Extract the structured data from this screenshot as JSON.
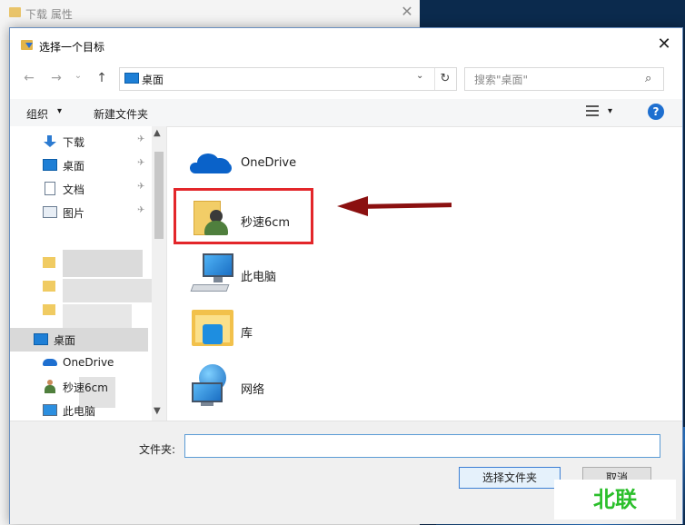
{
  "background_window": {
    "title": "下载 属性",
    "close": "✕"
  },
  "dialog": {
    "title": "选择一个目标",
    "close": "✕",
    "nav": {
      "back": "←",
      "forward": "→",
      "dropdown": "⌄",
      "up": "↑"
    },
    "address": {
      "location": "桌面",
      "dropdown": "⌄",
      "refresh": "↻"
    },
    "search": {
      "placeholder": "搜索\"桌面\"",
      "icon": "⌕"
    },
    "toolbar": {
      "organize": "组织",
      "organize_caret": "▾",
      "new_folder": "新建文件夹",
      "view_caret": "▾",
      "help": "?"
    },
    "nav_pane": {
      "items": [
        {
          "label": "下载",
          "pinned": true
        },
        {
          "label": "桌面",
          "pinned": true
        },
        {
          "label": "文档",
          "pinned": true
        },
        {
          "label": "图片",
          "pinned": true
        },
        {
          "label": "桌面"
        },
        {
          "label": "OneDrive"
        },
        {
          "label": "秒速6cm"
        },
        {
          "label": "此电脑"
        }
      ],
      "pin_icon": "✈",
      "scroll_up": "▲",
      "scroll_down": "▼"
    },
    "content_items": [
      {
        "label": "OneDrive"
      },
      {
        "label": "秒速6cm"
      },
      {
        "label": "此电脑"
      },
      {
        "label": "库"
      },
      {
        "label": "网络"
      }
    ],
    "footer": {
      "folder_label": "文件夹:",
      "folder_value": "",
      "select_button": "选择文件夹",
      "cancel_button": "取消"
    }
  },
  "watermark": "北联",
  "colors": {
    "highlight": "#e3262a",
    "arrow": "#8b1010",
    "accent": "#1e6fd0",
    "watermark": "#2bbf2b"
  }
}
